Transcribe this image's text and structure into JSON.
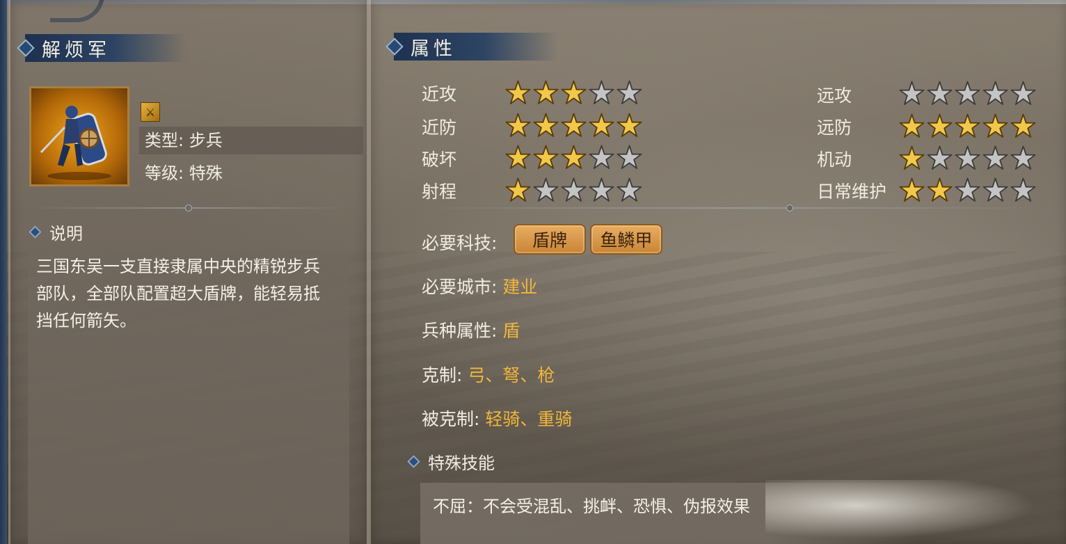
{
  "unit": {
    "name": "解烦军",
    "type_label": "类型: 步兵",
    "level_label": "等级: 特殊",
    "description_title": "说明",
    "description": "三国东吴一支直接隶属中央的精锐步兵部队，全部队配置超大盾牌，能轻易抵挡任何箭矢。"
  },
  "attributes": {
    "title": "属性",
    "max_stars": 5,
    "left": [
      {
        "label": "近攻",
        "stars": 3
      },
      {
        "label": "近防",
        "stars": 5
      },
      {
        "label": "破坏",
        "stars": 3
      },
      {
        "label": "射程",
        "stars": 1
      }
    ],
    "right": [
      {
        "label": "远攻",
        "stars": 0
      },
      {
        "label": "远防",
        "stars": 5
      },
      {
        "label": "机动",
        "stars": 1
      },
      {
        "label": "日常维护",
        "stars": 2
      }
    ]
  },
  "requirements": {
    "tech_label": "必要科技:",
    "techs": [
      "盾牌",
      "鱼鳞甲"
    ],
    "city_label": "必要城市:",
    "city": "建业",
    "troop_attr_label": "兵种属性:",
    "troop_attr": "盾",
    "counters_label": "克制:",
    "counters": "弓、弩、枪",
    "countered_by_label": "被克制:",
    "countered_by": "轻骑、重骑"
  },
  "skills": {
    "title": "特殊技能",
    "text": "不屈：不会受混乱、挑衅、恐惧、伪报效果"
  },
  "icons": {
    "header": "diamond-icon",
    "unit_class": "sword-icon",
    "star_on": "star-filled-icon",
    "star_off": "star-empty-icon"
  },
  "colors": {
    "star_on": "#f2c84b",
    "star_off": "#c4c4c4",
    "value_text": "#f2b63a",
    "header_bg": "#1f3e66"
  }
}
